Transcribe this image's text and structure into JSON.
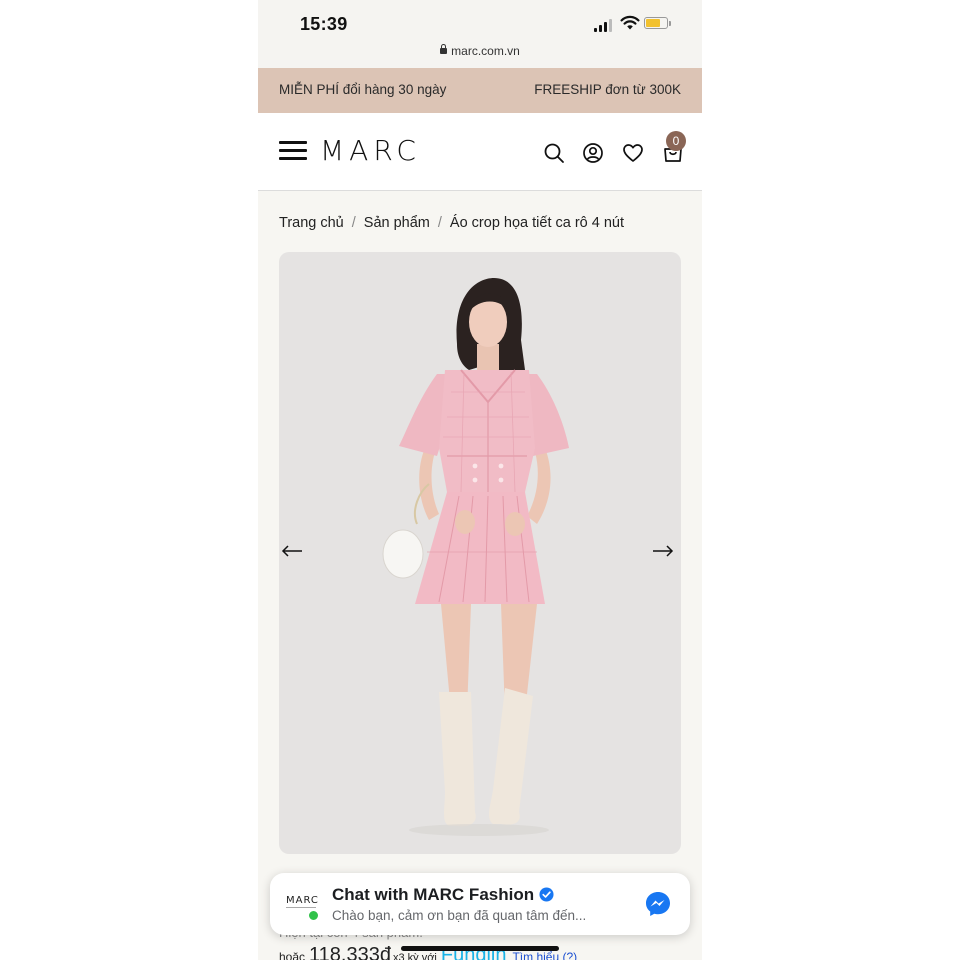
{
  "status_bar": {
    "time": "15:39",
    "url": "marc.com.vn"
  },
  "promo": {
    "left_text": "MIỄN PHÍ đổi hàng 30 ngày",
    "right_text": "FREESHIP đơn từ 300K"
  },
  "header": {
    "logo": "MARC",
    "icons": [
      "menu-icon",
      "search-icon",
      "account-icon",
      "heart-icon",
      "cart-icon"
    ],
    "cart_count": "0"
  },
  "breadcrumb": {
    "items": [
      "Trang chủ",
      "Sản phẩm",
      "Áo crop họa tiết ca rô 4 nút"
    ],
    "separator": "/"
  },
  "gallery": {
    "prev_icon": "arrow-left-icon",
    "next_icon": "arrow-right-icon"
  },
  "chat_widget": {
    "title": "Chat with MARC Fashion",
    "subtitle": "Chào bạn, cảm ơn bạn đã quan tâm đến...",
    "avatar_text": "MARC"
  },
  "product": {
    "stock_text": "Hiện tại còn 4 sản phẩm.",
    "or_label": "hoặc",
    "installment_price": "118.333đ",
    "installment_suffix": "x3 kỳ với",
    "installment_provider": "Fundiin",
    "learn_more": "Tìm hiểu (?)"
  },
  "colors": {
    "promo_bg": "#dcc4b5",
    "badge_bg": "#8a6656",
    "image_bg": "#e5e3e2",
    "messenger_blue": "#1877f2",
    "online_green": "#31c24a"
  }
}
